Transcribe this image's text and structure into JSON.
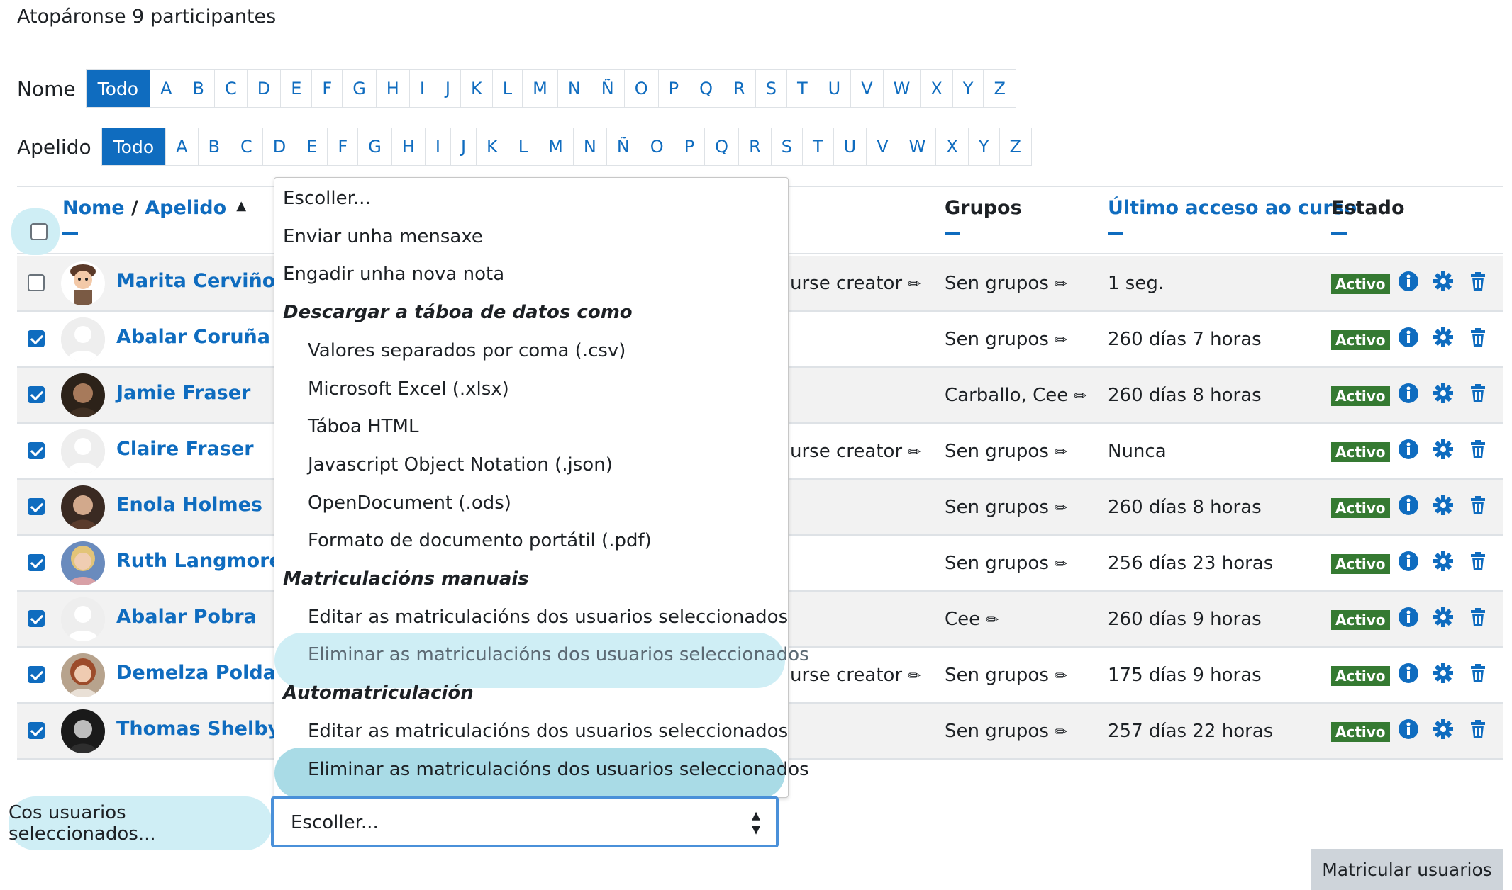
{
  "found_text": "Atopáronse 9 participantes",
  "filter_first": {
    "label": "Nome",
    "all": "Todo",
    "letters": [
      "A",
      "B",
      "C",
      "D",
      "E",
      "F",
      "G",
      "H",
      "I",
      "J",
      "K",
      "L",
      "M",
      "N",
      "Ñ",
      "O",
      "P",
      "Q",
      "R",
      "S",
      "T",
      "U",
      "V",
      "W",
      "X",
      "Y",
      "Z"
    ]
  },
  "filter_last": {
    "label": "Apelido",
    "all": "Todo",
    "letters": [
      "A",
      "B",
      "C",
      "D",
      "E",
      "F",
      "G",
      "H",
      "I",
      "J",
      "K",
      "L",
      "M",
      "N",
      "Ñ",
      "O",
      "P",
      "Q",
      "R",
      "S",
      "T",
      "U",
      "V",
      "W",
      "X",
      "Y",
      "Z"
    ]
  },
  "table": {
    "headers": {
      "name_first": "Nome",
      "name_sep": " / ",
      "name_last": "Apelido",
      "groups": "Grupos",
      "last_access": "Último acceso ao curso",
      "status": "Estado"
    },
    "rows": [
      {
        "name": "Marita Cerviño",
        "role": "urse creator",
        "groups": "Sen grupos",
        "access": "1 seg.",
        "status": "Activo",
        "checked": false,
        "avatar": "cartoon"
      },
      {
        "name": "Abalar Coruña",
        "role": "",
        "groups": "Sen grupos",
        "access": "260 días 7 horas",
        "status": "Activo",
        "checked": true,
        "avatar": "default"
      },
      {
        "name": "Jamie Fraser",
        "role": "",
        "groups": "Carballo, Cee",
        "access": "260 días 8 horas",
        "status": "Activo",
        "checked": true,
        "avatar": "photo-dark"
      },
      {
        "name": "Claire Fraser",
        "role": "urse creator",
        "groups": "Sen grupos",
        "access": "Nunca",
        "status": "Activo",
        "checked": true,
        "avatar": "default"
      },
      {
        "name": "Enola Holmes",
        "role": "",
        "groups": "Sen grupos",
        "access": "260 días 8 horas",
        "status": "Activo",
        "checked": true,
        "avatar": "photo-brown"
      },
      {
        "name": "Ruth Langmore",
        "role": "",
        "groups": "Sen grupos",
        "access": "256 días 23 horas",
        "status": "Activo",
        "checked": true,
        "avatar": "photo-blonde"
      },
      {
        "name": "Abalar Pobra",
        "role": "",
        "groups": "Cee",
        "access": "260 días 9 horas",
        "status": "Activo",
        "checked": true,
        "avatar": "default"
      },
      {
        "name": "Demelza Poldark",
        "role": "urse creator",
        "groups": "Sen grupos",
        "access": "175 días 9 horas",
        "status": "Activo",
        "checked": true,
        "avatar": "photo-red"
      },
      {
        "name": "Thomas Shelby",
        "role": "",
        "groups": "Sen grupos",
        "access": "257 días 22 horas",
        "status": "Activo",
        "checked": true,
        "avatar": "photo-bw"
      }
    ]
  },
  "dropdown": {
    "options": [
      {
        "text": "Escoller...",
        "kind": "plain"
      },
      {
        "text": "Enviar unha mensaxe",
        "kind": "plain"
      },
      {
        "text": "Engadir unha nova nota",
        "kind": "plain"
      },
      {
        "text": "Descargar a táboa de datos como",
        "kind": "group"
      },
      {
        "text": "Valores separados por coma (.csv)",
        "kind": "indent"
      },
      {
        "text": "Microsoft Excel (.xlsx)",
        "kind": "indent"
      },
      {
        "text": "Táboa HTML",
        "kind": "indent"
      },
      {
        "text": "Javascript Object Notation (.json)",
        "kind": "indent"
      },
      {
        "text": "OpenDocument (.ods)",
        "kind": "indent"
      },
      {
        "text": "Formato de documento portátil (.pdf)",
        "kind": "indent"
      },
      {
        "text": "Matriculacións manuais",
        "kind": "group"
      },
      {
        "text": "Editar as matriculacións dos usuarios seleccionados",
        "kind": "indent"
      },
      {
        "text": "Eliminar as matriculacións dos usuarios seleccionados",
        "kind": "indent",
        "highlight": "light"
      },
      {
        "text": "Automatriculación",
        "kind": "group"
      },
      {
        "text": "Editar as matriculacións dos usuarios seleccionados",
        "kind": "indent"
      },
      {
        "text": "Eliminar as matriculacións dos usuarios seleccionados",
        "kind": "indent",
        "highlight": "strong"
      }
    ]
  },
  "bulk": {
    "label": "Cos usuarios seleccionados...",
    "select_value": "Escoller..."
  },
  "enrol_button": "Matricular usuarios",
  "colors": {
    "accent": "#0f6cbf",
    "status_green": "#357a32",
    "highlight_light": "#cfeef5",
    "highlight_strong": "#a9dbe6"
  }
}
